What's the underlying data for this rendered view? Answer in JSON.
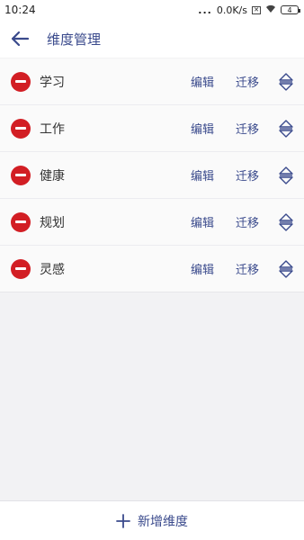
{
  "status_bar": {
    "time": "10:24",
    "dots": "...",
    "network_speed": "0.0K/s",
    "battery_level": "4"
  },
  "header": {
    "title": "维度管理",
    "back_icon": "arrow-left-icon"
  },
  "dimensions": [
    {
      "label": "学习",
      "edit_label": "编辑",
      "move_label": "迁移"
    },
    {
      "label": "工作",
      "edit_label": "编辑",
      "move_label": "迁移"
    },
    {
      "label": "健康",
      "edit_label": "编辑",
      "move_label": "迁移"
    },
    {
      "label": "规划",
      "edit_label": "编辑",
      "move_label": "迁移"
    },
    {
      "label": "灵感",
      "edit_label": "编辑",
      "move_label": "迁移"
    }
  ],
  "footer": {
    "add_label": "新增维度",
    "add_icon": "plus-icon"
  },
  "colors": {
    "accent": "#3a4a8c",
    "delete": "#d21e24"
  }
}
